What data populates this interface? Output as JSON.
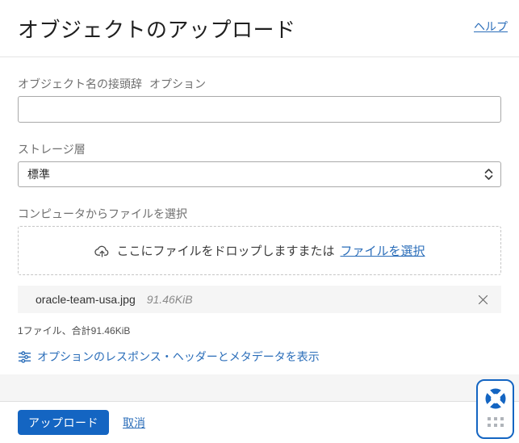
{
  "colors": {
    "accent": "#1465c2",
    "link": "#2a6db9",
    "file_row_bg": "#f5f5f5"
  },
  "header": {
    "title": "オブジェクトのアップロード",
    "help_label": "ヘルプ"
  },
  "form": {
    "prefix_label": "オブジェクト名の接頭辞",
    "prefix_optional": "オプション",
    "prefix_value": "",
    "storage_label": "ストレージ層",
    "storage_value": "標準",
    "file_select_label": "コンピュータからファイルを選択",
    "dropzone_text": "ここにファイルをドロップしますまたは",
    "dropzone_link": "ファイルを選択"
  },
  "files": [
    {
      "name": "oracle-team-usa.jpg",
      "size": "91.46KiB"
    }
  ],
  "files_summary": "1ファイル、合計91.46KiB",
  "metadata_link": "オプションのレスポンス・ヘッダーとメタデータを表示",
  "footer": {
    "upload_label": "アップロード",
    "cancel_label": "取消"
  }
}
